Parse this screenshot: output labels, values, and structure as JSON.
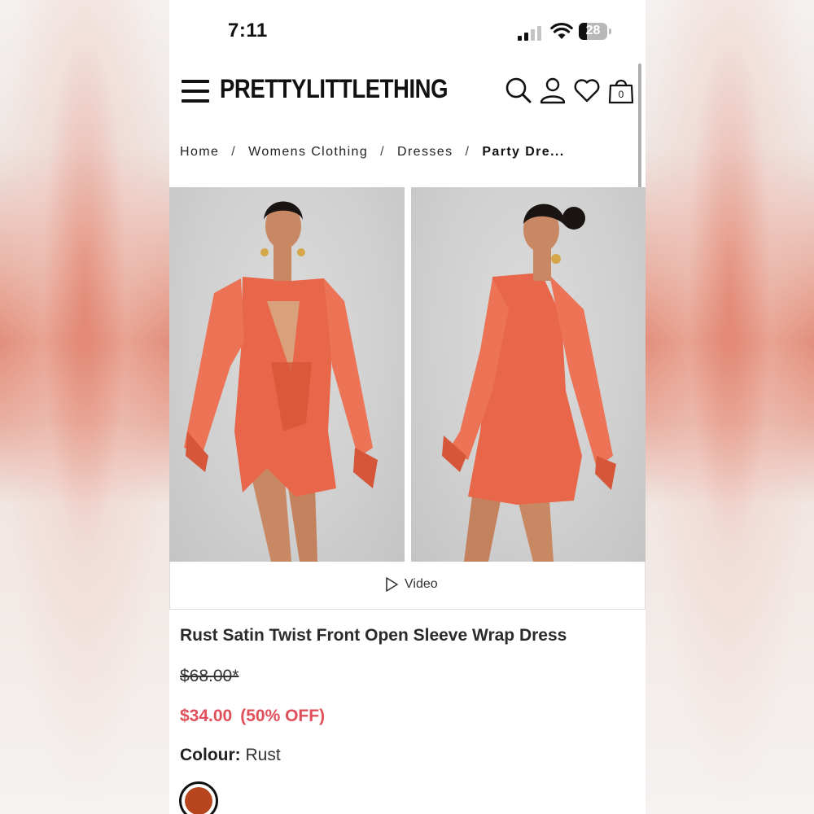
{
  "status_bar": {
    "time": "7:11",
    "battery": "28"
  },
  "header": {
    "logo": "PRETTYLITTLETHING",
    "cart_count": "0",
    "icons": [
      "menu-icon",
      "search-icon",
      "account-icon",
      "wishlist-heart-icon",
      "shopping-bag-icon"
    ]
  },
  "breadcrumb": {
    "items": [
      "Home",
      "Womens Clothing",
      "Dresses"
    ],
    "current": "Party Dre...",
    "separator": "/"
  },
  "gallery": {
    "video_label": "Video"
  },
  "product": {
    "title": "Rust Satin Twist Front Open Sleeve Wrap Dress",
    "original_price": "$68.00*",
    "sale_price": "$34.00",
    "discount": "(50% OFF)",
    "colour_label": "Colour:",
    "colour_value": "Rust",
    "swatch_color": "#b7461f"
  },
  "colors": {
    "sale": "#e0505a",
    "dress": "#e8674a",
    "backdrop": "#d2d2d2"
  }
}
